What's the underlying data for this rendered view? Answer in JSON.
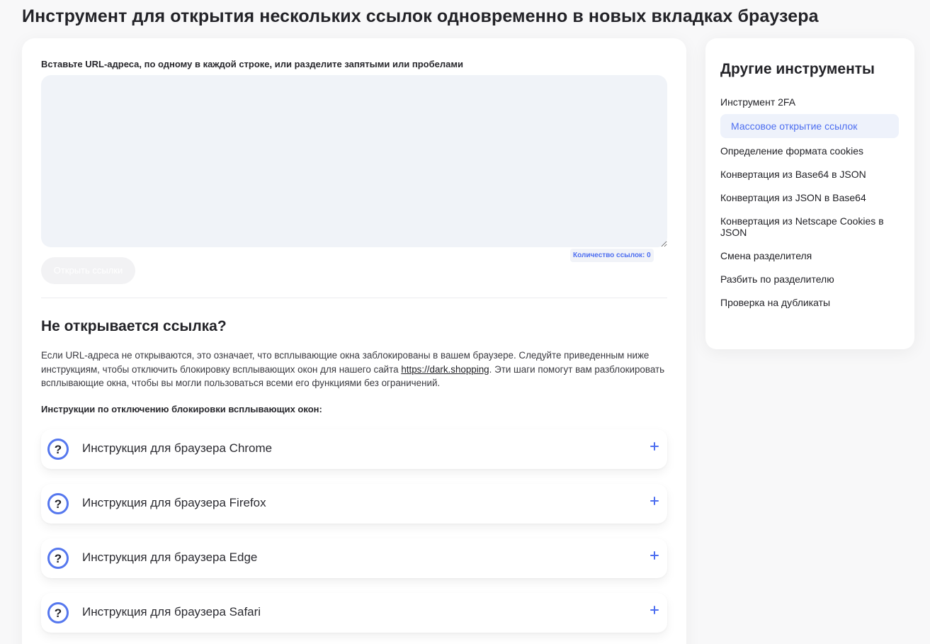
{
  "page": {
    "title": "Инструмент для открытия нескольких ссылок одновременно в новых вкладках браузера"
  },
  "form": {
    "label": "Вставьте URL-адреса, по одному в каждой строке, или разделите запятыми или пробелами",
    "textarea_value": "",
    "link_count": "Количество ссылок: 0",
    "open_button": "Открыть ссылки"
  },
  "help": {
    "title": "Не открывается ссылка?",
    "text_before": "Если URL-адреса не открываются, это означает, что всплывающие окна заблокированы в вашем браузере. Следуйте приведенным ниже инструкциям, чтобы отключить блокировку всплывающих окон для нашего сайта ",
    "link": "https://dark.shopping",
    "text_after": ". Эти шаги помогут вам разблокировать всплывающие окна, чтобы вы могли пользоваться всеми его функциями без ограничений.",
    "instructions_heading": "Инструкции по отключению блокировки всплывающих окон:",
    "accordion": [
      {
        "label": "Инструкция для браузера Chrome"
      },
      {
        "label": "Инструкция для браузера Firefox"
      },
      {
        "label": "Инструкция для браузера Edge"
      },
      {
        "label": "Инструкция для браузера Safari"
      }
    ]
  },
  "sidebar": {
    "title": "Другие инструменты",
    "items": [
      {
        "label": "Инструмент 2FA"
      },
      {
        "label": "Массовое открытие ссылок"
      },
      {
        "label": "Определение формата cookies"
      },
      {
        "label": "Конвертация из Base64 в JSON"
      },
      {
        "label": "Конвертация из JSON в Base64"
      },
      {
        "label": "Конвертация из Netscape Cookies в JSON"
      },
      {
        "label": "Смена разделителя"
      },
      {
        "label": "Разбить по разделителю"
      },
      {
        "label": "Проверка на дубликаты"
      }
    ]
  },
  "colors": {
    "accent": "#4d6ef0",
    "background": "#f8f8f9",
    "card": "#ffffff",
    "textarea_bg": "#f0f3f8"
  },
  "icons": {
    "accordion_icon": "question-circle-icon",
    "accordion_toggle": "plus-icon"
  }
}
